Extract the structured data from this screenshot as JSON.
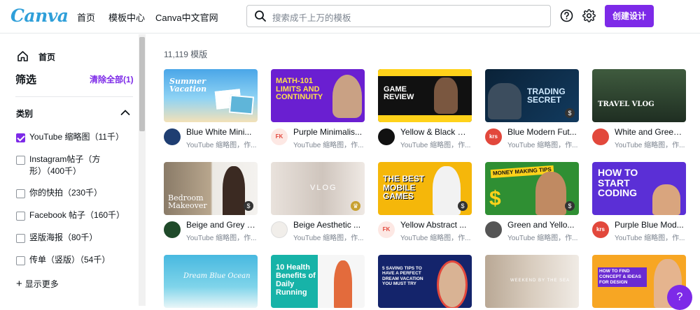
{
  "header": {
    "logo": "Canva",
    "nav": [
      "首页",
      "模板中心",
      "Canva中文官网"
    ],
    "search_placeholder": "搜索成千上万的模板",
    "create_button": "创建设计"
  },
  "sidebar": {
    "home": "首页",
    "filter_title": "筛选",
    "clear_all": "清除全部(1)",
    "category_title": "类别",
    "options": [
      {
        "label": "YouTube 缩略图（11千）",
        "checked": true
      },
      {
        "label": "Instagram帖子（方形）（400千）",
        "checked": false
      },
      {
        "label": "你的快拍（230千）",
        "checked": false
      },
      {
        "label": "Facebook 帖子（160千）",
        "checked": false
      },
      {
        "label": "竖版海报（80千）",
        "checked": false
      },
      {
        "label": "传单（竖版）（54千）",
        "checked": false
      }
    ],
    "show_more": "显示更多"
  },
  "main": {
    "result_count": "11,119 模版",
    "cards": [
      {
        "title": "Blue White Mini...",
        "subtitle": "YouTube 缩略图，作...",
        "thumb_text": "Summer Vacation"
      },
      {
        "title": "Purple Minimalis...",
        "subtitle": "YouTube 缩略图，作...",
        "thumb_text": "MATH-101 LIMITS AND CONTINUITY"
      },
      {
        "title": "Yellow & Black M...",
        "subtitle": "YouTube 缩略图，作...",
        "thumb_text": "GAME REVIEW"
      },
      {
        "title": "Blue Modern Fut...",
        "subtitle": "YouTube 缩略图，作...",
        "thumb_text": "TRADING SECRET"
      },
      {
        "title": "White and Green...",
        "subtitle": "YouTube 缩略图，作...",
        "thumb_text": "TRAVEL VLOG"
      },
      {
        "title": "Beige and Grey S...",
        "subtitle": "YouTube 缩略图，作...",
        "thumb_text": "Bedroom Makeover"
      },
      {
        "title": "Beige Aesthetic ...",
        "subtitle": "YouTube 缩略图，作...",
        "thumb_text": "VLOG"
      },
      {
        "title": "Yellow Abstract ...",
        "subtitle": "YouTube 缩略图，作...",
        "thumb_text": "THE BEST MOBILE GAMES"
      },
      {
        "title": "Green and Yello...",
        "subtitle": "YouTube 缩略图，作...",
        "thumb_text": "MONEY MAKING TIPS"
      },
      {
        "title": "Purple Blue Mod...",
        "subtitle": "YouTube 缩略图，作...",
        "thumb_text": "HOW TO START CODING"
      },
      {
        "title": "",
        "subtitle": "",
        "thumb_text": "Dream Blue Ocean"
      },
      {
        "title": "",
        "subtitle": "",
        "thumb_text": "10 Health Benefits of Daily Running"
      },
      {
        "title": "",
        "subtitle": "",
        "thumb_text": "5 SAVING TIPS TO HAVE A PERFECT DREAM VACATION YOU MUST TRY"
      },
      {
        "title": "",
        "subtitle": "",
        "thumb_text": "WEEKEND BY THE SEA"
      },
      {
        "title": "",
        "subtitle": "",
        "thumb_text": "HOW TO FIND CONCEPT & IDEAS FOR DESIGN"
      }
    ]
  },
  "help_button": "?",
  "colors": {
    "brand": "#7d2ae8",
    "logo": "#2f9fd9"
  }
}
